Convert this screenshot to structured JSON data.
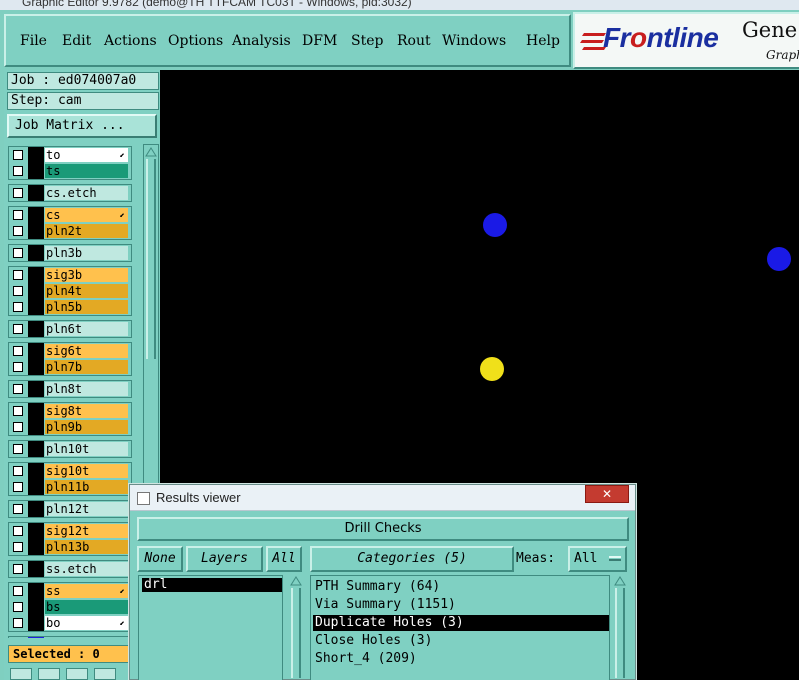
{
  "window": {
    "title": "Graphic Editor 9.9782 (demo@TH TTFCAM TC03T - Windows, pid:3032)"
  },
  "menubar": {
    "items": [
      "File",
      "Edit",
      "Actions",
      "Options",
      "Analysis",
      "DFM",
      "Step",
      "Rout",
      "Windows",
      "Help"
    ]
  },
  "logo": {
    "brand_pre": "Fr",
    "brand_o": "o",
    "brand_post": "ntline",
    "gene": "Gene",
    "graph": "Graphi"
  },
  "job": {
    "job_line": "Job : ed074007a0",
    "step_line": "Step: cam",
    "matrix_button": "Job Matrix ..."
  },
  "layers": [
    {
      "name": "to",
      "color": "white",
      "arrow": true
    },
    {
      "name": "ts",
      "color": "teal"
    },
    {
      "name": "cs.etch",
      "color": "light"
    },
    {
      "name": "cs",
      "color": "orange",
      "arrow": true
    },
    {
      "name": "pln2t",
      "color": "orange2"
    },
    {
      "name": "pln3b",
      "color": "light"
    },
    {
      "name": "sig3b",
      "color": "orange"
    },
    {
      "name": "pln4t",
      "color": "orange2"
    },
    {
      "name": "pln5b",
      "color": "orange2"
    },
    {
      "name": "pln6t",
      "color": "light"
    },
    {
      "name": "sig6t",
      "color": "orange"
    },
    {
      "name": "pln7b",
      "color": "orange2"
    },
    {
      "name": "pln8t",
      "color": "light"
    },
    {
      "name": "sig8t",
      "color": "orange"
    },
    {
      "name": "pln9b",
      "color": "orange2"
    },
    {
      "name": "pln10t",
      "color": "light"
    },
    {
      "name": "sig10t",
      "color": "orange"
    },
    {
      "name": "pln11b",
      "color": "orange2"
    },
    {
      "name": "pln12t",
      "color": "light"
    },
    {
      "name": "sig12t",
      "color": "orange"
    },
    {
      "name": "pln13b",
      "color": "orange2"
    },
    {
      "name": "ss.etch",
      "color": "light"
    },
    {
      "name": "ss",
      "color": "orange",
      "arrow": true
    },
    {
      "name": "bs",
      "color": "teal"
    },
    {
      "name": "bo",
      "color": "white",
      "arrow": true
    },
    {
      "name": "drl",
      "color": "light",
      "swatch": "#2020e0"
    }
  ],
  "selected_label": "Selected : 0",
  "canvas": {
    "pads": [
      {
        "color": "#1a1ae6"
      },
      {
        "color": "#1a1ae6"
      },
      {
        "color": "#f0e01a"
      }
    ]
  },
  "results_viewer": {
    "title": "Results viewer",
    "close_label": "✕",
    "header": "Drill Checks",
    "none_button": "None",
    "layers_button": "Layers",
    "all_button": "All",
    "categories_button": "Categories (5)",
    "meas_label": "Meas:",
    "meas_value": "All",
    "layer_list": [
      "drl"
    ],
    "categories": [
      {
        "label": "PTH Summary (64)",
        "selected": false
      },
      {
        "label": "Via Summary (1151)",
        "selected": false
      },
      {
        "label": "Duplicate Holes (3)",
        "selected": true
      },
      {
        "label": "Close Holes (3)",
        "selected": false
      },
      {
        "label": "Short_4 (209)",
        "selected": false
      }
    ]
  }
}
